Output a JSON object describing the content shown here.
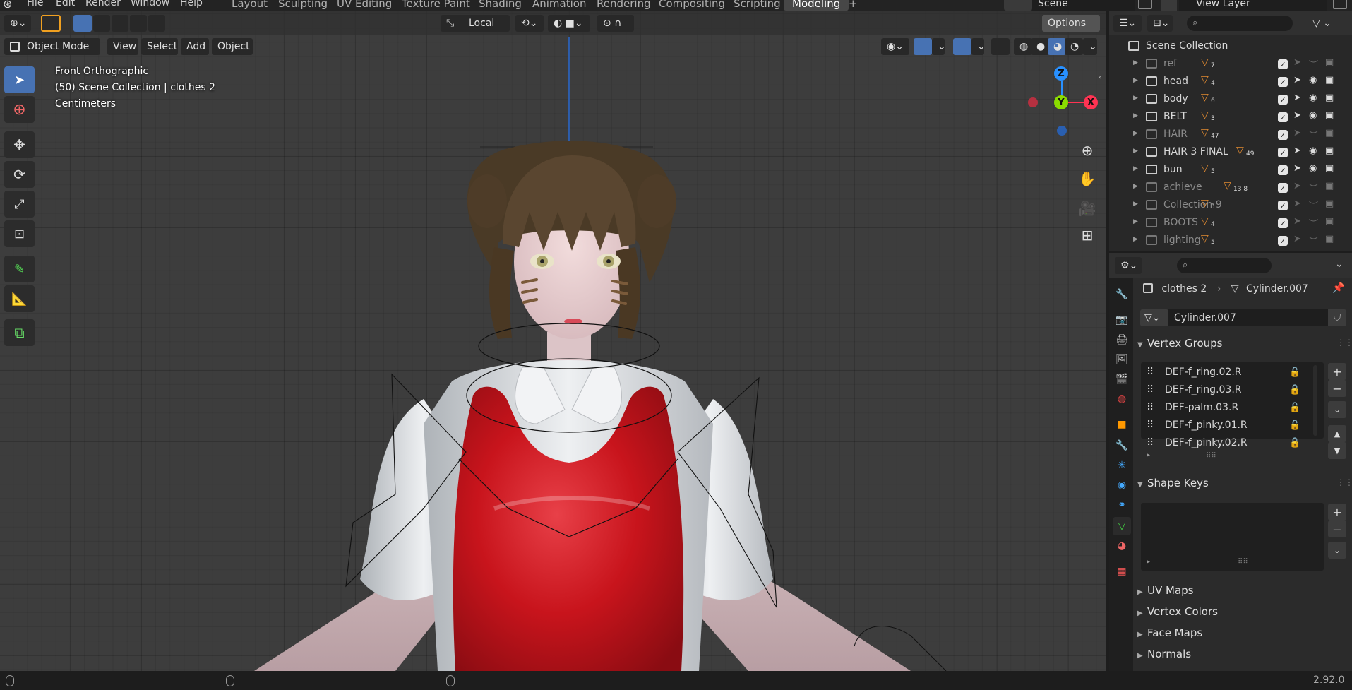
{
  "menu": {
    "items": [
      "File",
      "Edit",
      "Render",
      "Window",
      "Help"
    ]
  },
  "workspaces": {
    "tabs": [
      "Layout",
      "Sculpting",
      "UV Editing",
      "Texture Paint",
      "Shading",
      "Animation",
      "Rendering",
      "Compositing",
      "Scripting",
      "Modeling"
    ],
    "active": "Modeling",
    "add": "+"
  },
  "scene": {
    "name": "Scene",
    "view_layer": "View Layer"
  },
  "viewport_header": {
    "transform_orientation": "Local",
    "options_label": "Options",
    "mode_label": "Object Mode",
    "menus": [
      "View",
      "Select",
      "Add",
      "Object"
    ]
  },
  "overlay": {
    "view_name": "Front Orthographic",
    "collection_info": "(50) Scene Collection | clothes 2",
    "units": "Centimeters"
  },
  "gizmo": {
    "z": "Z",
    "y": "Y",
    "x": "X",
    "colors": {
      "x": "#ff3352",
      "y": "#8bdc00",
      "z": "#2890ff"
    }
  },
  "outliner": {
    "root": "Scene Collection",
    "rows": [
      {
        "name": "ref",
        "badge": "7",
        "dim": true
      },
      {
        "name": "head",
        "badge": "4",
        "dim": false
      },
      {
        "name": "body",
        "badge": "6",
        "dim": false
      },
      {
        "name": "BELT",
        "badge": "3",
        "dim": false
      },
      {
        "name": "HAIR",
        "badge": "47",
        "dim": true
      },
      {
        "name": "HAIR 3 FINAL",
        "badge": "49",
        "dim": false
      },
      {
        "name": "bun",
        "badge": "5",
        "dim": false
      },
      {
        "name": "achieve",
        "badge": "13 8",
        "dim": true
      },
      {
        "name": "Collection 9",
        "badge": "3",
        "dim": true
      },
      {
        "name": "BOOTS",
        "badge": "4",
        "dim": true
      },
      {
        "name": "lighting",
        "badge": "5",
        "dim": true
      }
    ]
  },
  "properties": {
    "breadcrumb_object": "clothes 2",
    "breadcrumb_data": "Cylinder.007",
    "data_name": "Cylinder.007",
    "panels": {
      "vertex_groups": "Vertex Groups",
      "shape_keys": "Shape Keys",
      "uv_maps": "UV Maps",
      "vertex_colors": "Vertex Colors",
      "face_maps": "Face Maps",
      "normals": "Normals"
    },
    "vertex_groups": [
      "DEF-f_ring.02.R",
      "DEF-f_ring.03.R",
      "DEF-palm.03.R",
      "DEF-f_pinky.01.R",
      "DEF-f_pinky.02.R"
    ],
    "add": "+",
    "remove": "−",
    "more": "⌄",
    "up": "▲",
    "down": "▼"
  },
  "status": {
    "version": "2.92.0"
  },
  "colors": {
    "accent": "#4772b3",
    "active_tab": "#474747",
    "red_dress": "#c8141c"
  }
}
